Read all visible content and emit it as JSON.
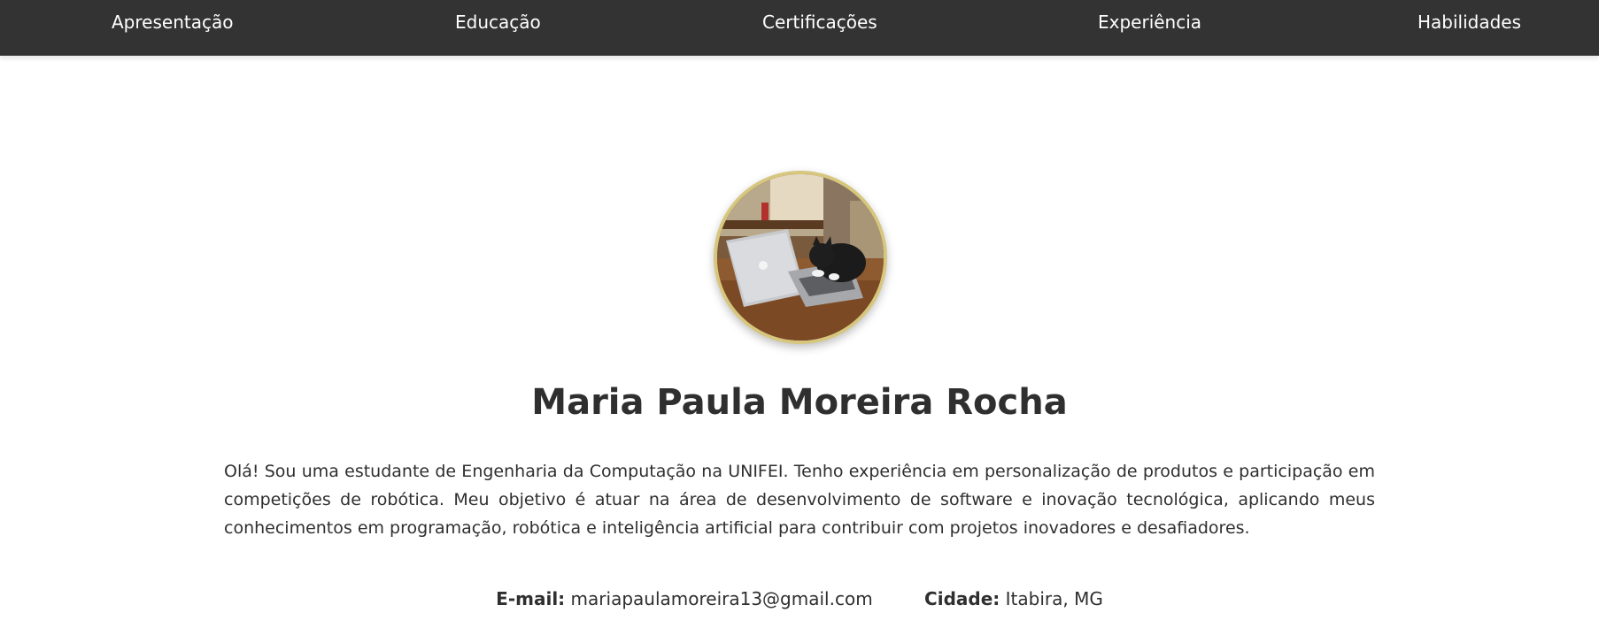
{
  "nav": {
    "items": [
      {
        "label": "Apresentação"
      },
      {
        "label": "Educação"
      },
      {
        "label": "Certificações"
      },
      {
        "label": "Experiência"
      },
      {
        "label": "Habilidades"
      }
    ]
  },
  "profile": {
    "name": "Maria Paula Moreira Rocha",
    "bio": "Olá! Sou uma estudante de Engenharia da Computação na UNIFEI. Tenho experiência em personalização de produtos e participação em competições de robótica. Meu objetivo é atuar na área de desenvolvimento de software e inovação tecnológica, aplicando meus conhecimentos em programação, robótica e inteligência artificial para contribuir com projetos inovadores e desafiadores."
  },
  "contact": {
    "email_label": "E-mail:",
    "email_value": "mariapaulamoreira13@gmail.com",
    "city_label": "Cidade:",
    "city_value": "Itabira, MG"
  },
  "colors": {
    "navbar_bg": "#333333",
    "nav_text": "#ffffff",
    "avatar_border": "#d7c67e",
    "body_text": "#2f2f2f"
  }
}
